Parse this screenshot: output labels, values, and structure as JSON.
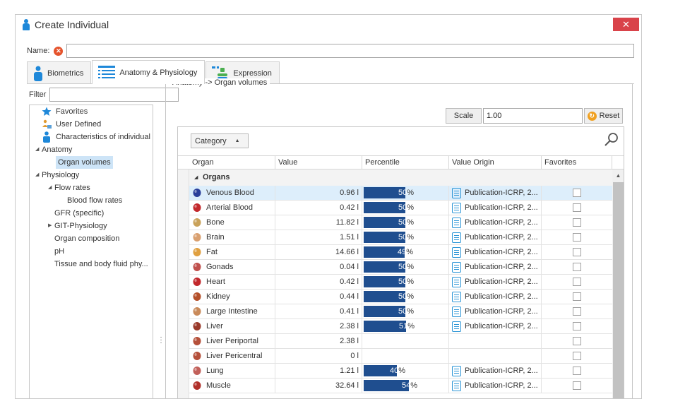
{
  "window": {
    "title": "Create Individual",
    "close_label": "✕"
  },
  "name_field": {
    "label": "Name:",
    "value": "",
    "error_icon": "error-icon"
  },
  "tabs": [
    {
      "label": "Biometrics",
      "icon": "person-icon",
      "active": false
    },
    {
      "label": "Anatomy & Physiology",
      "icon": "list-icon",
      "active": true
    },
    {
      "label": "Expression",
      "icon": "expression-icon",
      "active": false
    }
  ],
  "filter": {
    "label": "Filter",
    "value": ""
  },
  "tree": [
    {
      "label": "Favorites",
      "icon": "star-icon"
    },
    {
      "label": "User Defined",
      "icon": "user-defined-icon"
    },
    {
      "label": "Characteristics of individual",
      "icon": "person-icon"
    },
    {
      "label": "Anatomy",
      "caret": "expanded"
    },
    {
      "label": "Organ volumes",
      "selected": true
    },
    {
      "label": "Physiology",
      "caret": "expanded"
    },
    {
      "label": "Flow rates",
      "caret": "expanded"
    },
    {
      "label": "Blood flow rates"
    },
    {
      "label": "GFR (specific)"
    },
    {
      "label": "GIT-Physiology",
      "caret": "collapsed"
    },
    {
      "label": "Organ composition"
    },
    {
      "label": "pH"
    },
    {
      "label": "Tissue and body fluid phy..."
    }
  ],
  "group_title": "Anatomy -> Organ volumes",
  "scale": {
    "button_label": "Scale",
    "value": "1.00",
    "reset_label": "Reset"
  },
  "grid": {
    "group_by": "Category",
    "columns": [
      "Organ",
      "Value",
      "Percentile",
      "Value Origin",
      "Favorites"
    ],
    "group_label": "Organs",
    "rows": [
      {
        "organ": "Venous Blood",
        "value": "0.96 l",
        "percentile": "50%",
        "pct": 50,
        "origin": "Publication-ICRP, 2...",
        "icon": "venous-blood-icon",
        "color": "#2a3f9a",
        "selected": true
      },
      {
        "organ": "Arterial Blood",
        "value": "0.42 l",
        "percentile": "50%",
        "pct": 50,
        "origin": "Publication-ICRP, 2...",
        "icon": "arterial-blood-icon",
        "color": "#c2282c"
      },
      {
        "organ": "Bone",
        "value": "11.82 l",
        "percentile": "50%",
        "pct": 50,
        "origin": "Publication-ICRP, 2...",
        "icon": "bone-icon",
        "color": "#c9a25a"
      },
      {
        "organ": "Brain",
        "value": "1.51 l",
        "percentile": "50%",
        "pct": 50,
        "origin": "Publication-ICRP, 2...",
        "icon": "brain-icon",
        "color": "#d9a070"
      },
      {
        "organ": "Fat",
        "value": "14.66 l",
        "percentile": "49%",
        "pct": 49,
        "origin": "Publication-ICRP, 2...",
        "icon": "fat-icon",
        "color": "#e0a040"
      },
      {
        "organ": "Gonads",
        "value": "0.04 l",
        "percentile": "50%",
        "pct": 50,
        "origin": "Publication-ICRP, 2...",
        "icon": "gonads-icon",
        "color": "#c0504d"
      },
      {
        "organ": "Heart",
        "value": "0.42 l",
        "percentile": "50%",
        "pct": 50,
        "origin": "Publication-ICRP, 2...",
        "icon": "heart-icon",
        "color": "#c2282c"
      },
      {
        "organ": "Kidney",
        "value": "0.44 l",
        "percentile": "50%",
        "pct": 50,
        "origin": "Publication-ICRP, 2...",
        "icon": "kidney-icon",
        "color": "#b5502a"
      },
      {
        "organ": "Large Intestine",
        "value": "0.41 l",
        "percentile": "50%",
        "pct": 50,
        "origin": "Publication-ICRP, 2...",
        "icon": "large-intestine-icon",
        "color": "#c98a5a"
      },
      {
        "organ": "Liver",
        "value": "2.38 l",
        "percentile": "51%",
        "pct": 51,
        "origin": "Publication-ICRP, 2...",
        "icon": "liver-icon",
        "color": "#9a3a2a"
      },
      {
        "organ": "Liver Periportal",
        "value": "2.38 l",
        "percentile": "",
        "pct": 0,
        "origin": "",
        "icon": "liver-periportal-icon",
        "color": "#b5503a"
      },
      {
        "organ": "Liver Pericentral",
        "value": "0 l",
        "percentile": "",
        "pct": 0,
        "origin": "",
        "icon": "liver-pericentral-icon",
        "color": "#b5503a"
      },
      {
        "organ": "Lung",
        "value": "1.21 l",
        "percentile": "40%",
        "pct": 40,
        "origin": "Publication-ICRP, 2...",
        "icon": "lung-icon",
        "color": "#c2605a"
      },
      {
        "organ": "Muscle",
        "value": "32.64 l",
        "percentile": "54%",
        "pct": 54,
        "origin": "Publication-ICRP, 2...",
        "icon": "muscle-icon",
        "color": "#b0302a"
      }
    ]
  },
  "colors": {
    "accent": "#1e88d9",
    "bar": "#1f4e8f",
    "close": "#d9434a",
    "selected_row": "#ddeefb"
  }
}
